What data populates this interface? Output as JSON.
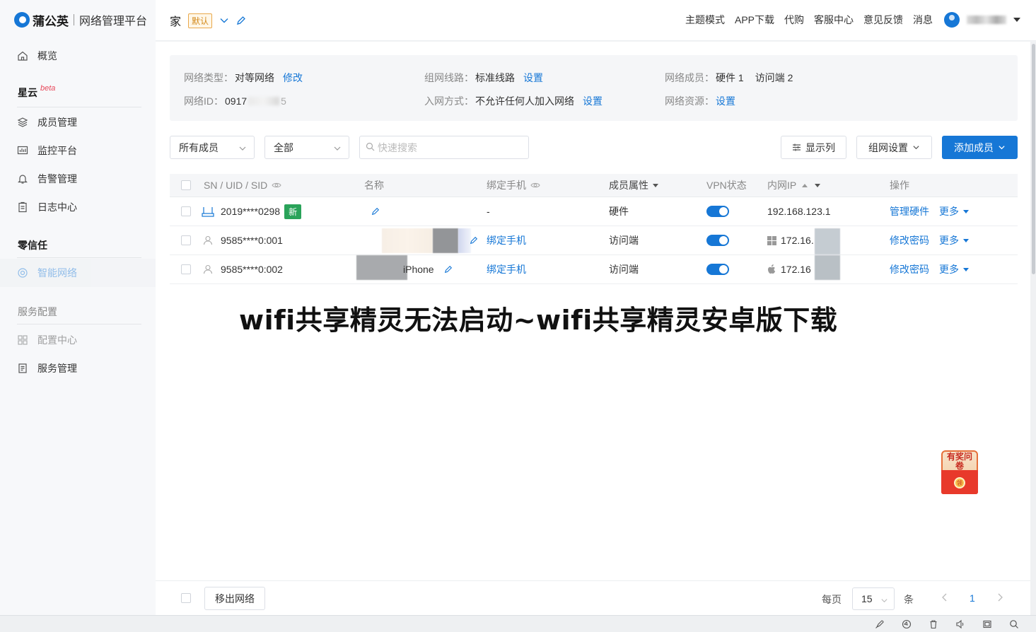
{
  "brand": {
    "name": "蒲公英",
    "subtitle": "网络管理平台"
  },
  "sidebar": {
    "items": [
      {
        "label": "概览",
        "icon": "home-icon"
      },
      {
        "label": "成员管理",
        "icon": "layers-icon"
      },
      {
        "label": "监控平台",
        "icon": "monitor-chart-icon"
      },
      {
        "label": "告警管理",
        "icon": "bell-icon"
      },
      {
        "label": "日志中心",
        "icon": "clipboard-icon"
      },
      {
        "label": "智能网络",
        "icon": "network-icon"
      },
      {
        "label": "配置中心",
        "icon": "grid-icon"
      },
      {
        "label": "服务管理",
        "icon": "document-icon"
      }
    ],
    "sections": {
      "xingyun": "星云",
      "beta": "beta",
      "zero_trust": "零信任",
      "service_config": "服务配置"
    }
  },
  "header": {
    "network_name": "家",
    "default_badge": "默认",
    "links": [
      "主题模式",
      "APP下载",
      "代购",
      "客服中心",
      "意见反馈",
      "消息"
    ]
  },
  "info": {
    "net_type_label": "网络类型：",
    "net_type_value": "对等网络",
    "net_type_action": "修改",
    "route_label": "组网线路：",
    "route_value": "标准线路",
    "route_action": "设置",
    "members_label": "网络成员：",
    "members_hw": "硬件 1",
    "members_clients": "访问端 2",
    "id_label": "网络ID：",
    "id_value": "0917",
    "id_tail": "5",
    "join_label": "入网方式：",
    "join_value": "不允许任何人加入网络",
    "join_action": "设置",
    "resource_label": "网络资源：",
    "resource_action": "设置"
  },
  "toolbar": {
    "member_filter": "所有成员",
    "type_filter": "全部",
    "search_placeholder": "快速搜索",
    "columns_button": "显示列",
    "network_settings_button": "组网设置",
    "add_member_button": "添加成员"
  },
  "table": {
    "headers": {
      "sn": "SN / UID / SID",
      "name": "名称",
      "phone": "绑定手机",
      "attr": "成员属性",
      "vpn": "VPN状态",
      "ip": "内网IP",
      "ops": "操作"
    },
    "rows": [
      {
        "id": "2019****0298",
        "badge": "新",
        "name": "",
        "phone": "-",
        "attr": "硬件",
        "vpn_on": true,
        "ip": "192.168.123.1",
        "action": "管理硬件",
        "more": "更多"
      },
      {
        "id": "9585****0:001",
        "name": "",
        "phone": "绑定手机",
        "attr": "访问端",
        "vpn_on": true,
        "ip": "172.16.",
        "action": "修改密码",
        "more": "更多"
      },
      {
        "id": "9585****0:002",
        "name": "iPhone",
        "phone": "绑定手机",
        "attr": "访问端",
        "vpn_on": true,
        "ip": "172.16",
        "action": "修改密码",
        "more": "更多"
      }
    ]
  },
  "overlay_title": "wifi共享精灵无法启动~wifi共享精灵安卓版下载",
  "survey": {
    "text": "有奖问卷",
    "coin": "领"
  },
  "footer": {
    "remove_button": "移出网络",
    "per_page_label": "每页",
    "per_page_value": "15",
    "unit": "条",
    "page": "1"
  }
}
